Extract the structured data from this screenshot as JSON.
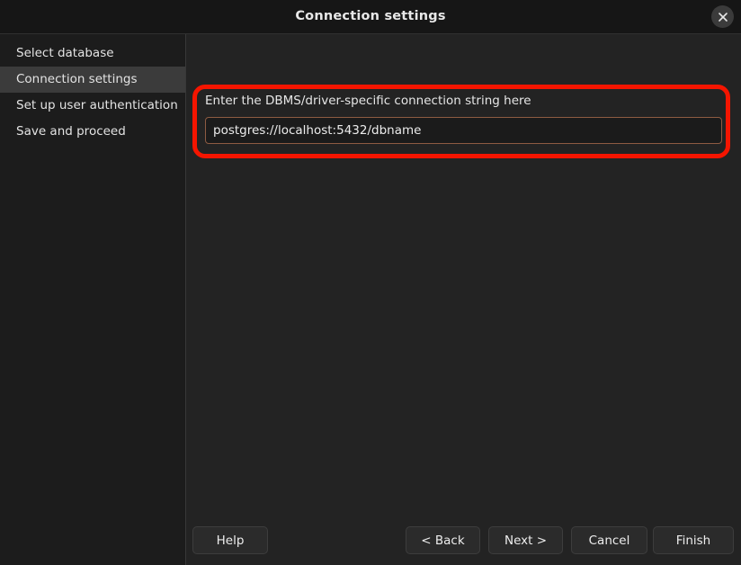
{
  "window": {
    "title": "Connection settings",
    "close_icon": "close-icon"
  },
  "sidebar": {
    "items": [
      {
        "label": "Select database",
        "selected": false
      },
      {
        "label": "Connection settings",
        "selected": true
      },
      {
        "label": "Set up user authentication",
        "selected": false
      },
      {
        "label": "Save and proceed",
        "selected": false
      }
    ]
  },
  "main": {
    "field": {
      "label": "Enter the DBMS/driver-specific connection string here",
      "value": "postgres://localhost:5432/dbname",
      "placeholder": "postgres://localhost:5432/dbname"
    },
    "annotation": {
      "color": "#f51500"
    }
  },
  "buttons": {
    "help": "Help",
    "back": "< Back",
    "next": "Next >",
    "cancel": "Cancel",
    "finish": "Finish"
  },
  "colors": {
    "titlebar_bg": "#161616",
    "sidebar_bg": "#1c1c1c",
    "main_bg": "#232323",
    "selected_item_bg": "#3b3b3b",
    "input_border": "#8d5b42",
    "annotation_red": "#f51500"
  }
}
